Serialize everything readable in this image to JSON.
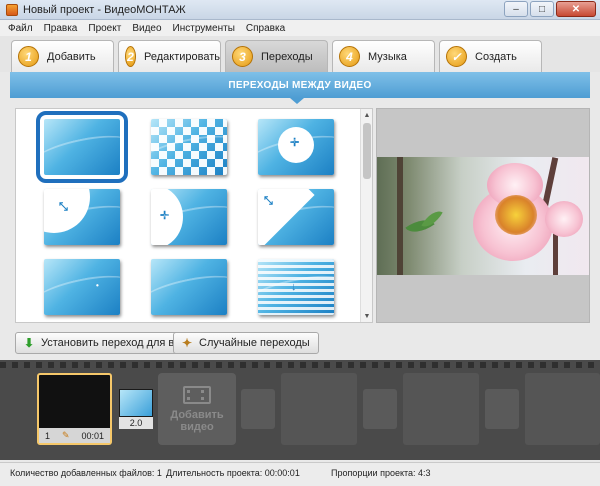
{
  "window": {
    "title": "Новый проект - ВидеоМОНТАЖ",
    "minimize_label": "–",
    "maximize_label": "□",
    "close_label": "✕"
  },
  "menu": [
    "Файл",
    "Правка",
    "Проект",
    "Видео",
    "Инструменты",
    "Справка"
  ],
  "tabs": [
    {
      "num": "1",
      "label": "Добавить",
      "active": false
    },
    {
      "num": "2",
      "label": "Редактировать",
      "active": false
    },
    {
      "num": "3",
      "label": "Переходы",
      "active": true
    },
    {
      "num": "4",
      "label": "Музыка",
      "active": false
    },
    {
      "num": "✓",
      "label": "Создать",
      "active": false
    }
  ],
  "section_title": "ПЕРЕХОДЫ МЕЖДУ ВИДЕО",
  "transitions": [
    {
      "name": "fade",
      "selected": true
    },
    {
      "name": "checker"
    },
    {
      "name": "circle"
    },
    {
      "name": "circle-top-left"
    },
    {
      "name": "circle-left"
    },
    {
      "name": "diagonal"
    },
    {
      "name": "dissolve"
    },
    {
      "name": "pixel"
    },
    {
      "name": "blinds-down"
    }
  ],
  "buttons": {
    "set_all": "Установить переход для всех",
    "random": "Случайные переходы"
  },
  "timeline": {
    "clip": {
      "index": "1",
      "duration": "00:01"
    },
    "transition_duration": "2.0",
    "add_video_label": "Добавить видео"
  },
  "status": {
    "files_label": "Количество добавленных файлов: 1",
    "duration_label": "Длительность проекта:  00:00:01",
    "aspect_label": "Пропорции проекта: 4:3"
  }
}
